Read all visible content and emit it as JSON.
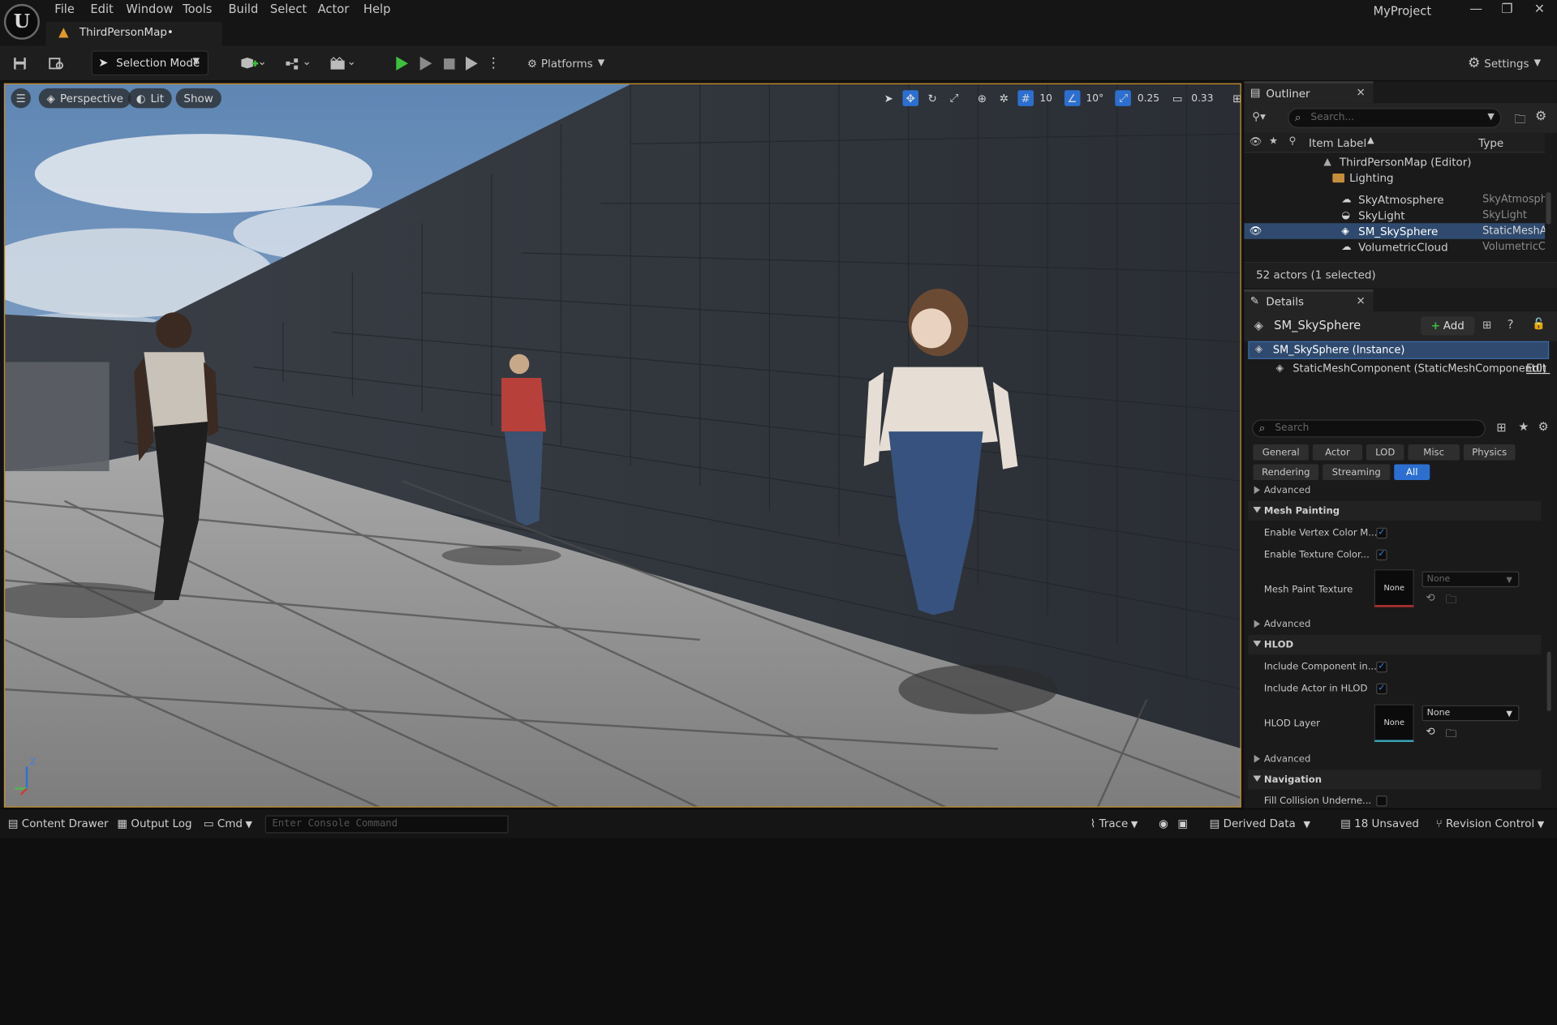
{
  "app": {
    "project_name": "MyProject",
    "menu": [
      "File",
      "Edit",
      "Window",
      "Tools",
      "Build",
      "Select",
      "Actor",
      "Help"
    ],
    "map_tab": "ThirdPersonMap•"
  },
  "toolbar": {
    "selection_mode": "Selection Mode",
    "platforms": "Platforms",
    "settings": "Settings"
  },
  "viewport": {
    "view_mode": "Perspective",
    "lighting_mode": "Lit",
    "show": "Show",
    "grid_snap": "10",
    "rotation_snap": "10°",
    "scale_snap": "0.25",
    "camera_speed": "0.33",
    "axis_z": "Z"
  },
  "outliner": {
    "title": "Outliner",
    "search_placeholder": "Search...",
    "col_label": "Item Label",
    "col_type": "Type",
    "items": [
      {
        "label": "ThirdPersonMap (Editor)",
        "type": "",
        "icon": "map-icon"
      },
      {
        "label": "Lighting",
        "type": "",
        "icon": "folder-icon"
      },
      {
        "label": "SkyAtmosphere",
        "type": "SkyAtmosphe",
        "icon": "sky-atmosphere-icon"
      },
      {
        "label": "SkyLight",
        "type": "SkyLight",
        "icon": "skylight-icon"
      },
      {
        "label": "SM_SkySphere",
        "type": "StaticMeshAc",
        "icon": "static-mesh-icon",
        "selected": true
      },
      {
        "label": "VolumetricCloud",
        "type": "VolumetricClc",
        "icon": "cloud-icon"
      }
    ],
    "status": "52 actors (1 selected)"
  },
  "details": {
    "title": "Details",
    "actor_name": "SM_SkySphere",
    "add_label": "Add",
    "instance_label": "SM_SkySphere (Instance)",
    "component_label": "StaticMeshComponent (StaticMeshComponent0)",
    "edit_link": "Edit i",
    "search_placeholder": "Search",
    "categories_row1": [
      "General",
      "Actor",
      "LOD",
      "Misc",
      "Physics"
    ],
    "categories_row2": [
      "Rendering",
      "Streaming",
      "All"
    ],
    "active_category": "All",
    "advanced_label": "Advanced",
    "mesh_painting": {
      "title": "Mesh Painting",
      "enable_vertex_color": "Enable Vertex Color M...",
      "enable_texture_color": "Enable Texture Color...",
      "mesh_paint_texture": "Mesh Paint Texture",
      "texture_value": "None",
      "texture_combo": "None"
    },
    "hlod": {
      "title": "HLOD",
      "include_component": "Include Component in...",
      "include_actor": "Include Actor in HLOD",
      "hlod_layer": "HLOD Layer",
      "layer_value": "None",
      "layer_combo": "None"
    },
    "navigation": {
      "title": "Navigation",
      "fill_collision": "Fill Collision Underne..."
    }
  },
  "statusbar": {
    "content_drawer": "Content Drawer",
    "output_log": "Output Log",
    "cmd": "Cmd",
    "console_placeholder": "Enter Console Command",
    "trace": "Trace",
    "derived_data": "Derived Data",
    "unsaved": "18 Unsaved",
    "revision_control": "Revision Control"
  },
  "colors": {
    "accent": "#2c6fd1",
    "play": "#3fbf3f",
    "selection_border": "#c98a1e"
  }
}
